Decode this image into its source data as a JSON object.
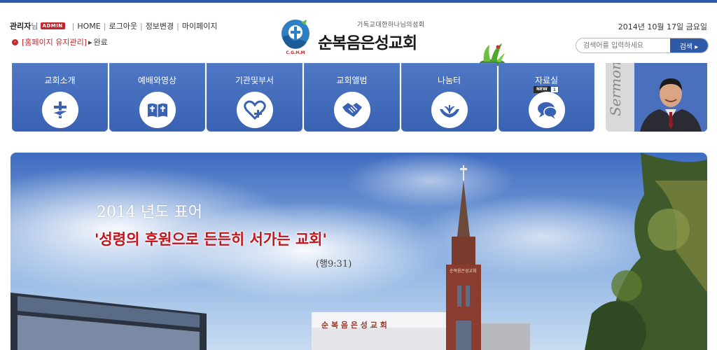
{
  "header": {
    "admin_name": "관리자",
    "admin_suffix": "님",
    "admin_badge": "ADMIN",
    "links": [
      "HOME",
      "로그아웃",
      "정보변경",
      "마이페이지"
    ],
    "maintenance_link": "[홈페이지 유지관리]",
    "maintenance_status": "완료",
    "logo_subtitle": "기독교대한하나님의성회",
    "logo_name": "순복음은성교회",
    "logo_mark_text": "C.G.H.M",
    "date": "2014년 10월 17일 금요일",
    "search_placeholder": "검색어를 입력하세요",
    "search_button": "검색 ▸"
  },
  "nav": {
    "items": [
      {
        "label": "교회소개",
        "icon": "dove-cross-icon"
      },
      {
        "label": "예배와영상",
        "icon": "bible-icon"
      },
      {
        "label": "기관및부서",
        "icon": "heart-plus-icon"
      },
      {
        "label": "교회앨범",
        "icon": "handshake-icon"
      },
      {
        "label": "나눔터",
        "icon": "hands-sprout-icon"
      },
      {
        "label": "자료실",
        "icon": "chat-bubbles-icon"
      }
    ],
    "new_badge": "NEW",
    "new_count": "1",
    "sermon_label": "Sermon"
  },
  "banner": {
    "year_line": "2014 년도 표어",
    "motto": "'성령의 후원으로 든든히 서가는 교회'",
    "verse": "(행9:31)",
    "church_sign": "순 복 음 은 성 교 회",
    "tower_sign": "순복음은성교회"
  },
  "colors": {
    "primary_blue": "#3a62b3",
    "accent_red": "#c1151c"
  }
}
